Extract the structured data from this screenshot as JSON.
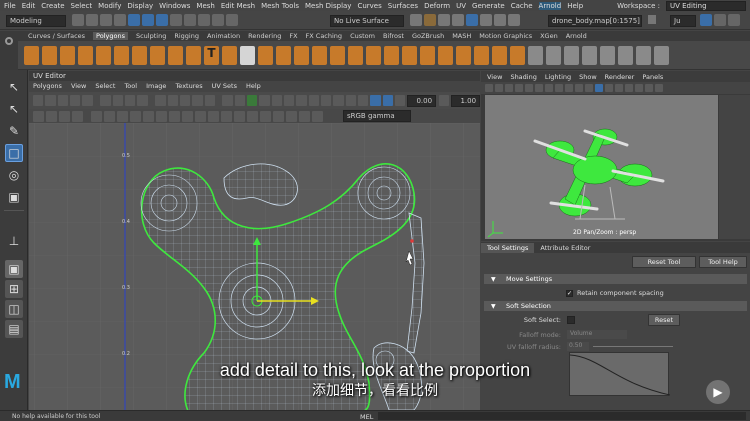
{
  "menubar": {
    "items": [
      "File",
      "Edit",
      "Create",
      "Select",
      "Modify",
      "Display",
      "Windows",
      "Mesh",
      "Edit Mesh",
      "Mesh Tools",
      "Mesh Display",
      "Curves",
      "Surfaces",
      "Deform",
      "UV",
      "Generate",
      "Cache",
      "Arnold",
      "Help"
    ],
    "workspace_label": "Workspace :",
    "workspace_value": "UV Editing"
  },
  "statusline": {
    "mode": "Modeling",
    "live_surface": "No Live Surface",
    "file_field": "drone_body.map[0:1575]",
    "user": "Ju"
  },
  "shelf_tabs": [
    "Curves / Surfaces",
    "Polygons",
    "Sculpting",
    "Rigging",
    "Animation",
    "Rendering",
    "FX",
    "FX Caching",
    "Custom",
    "Bifrost",
    "GoZBrush",
    "MASH",
    "Motion Graphics",
    "XGen",
    "Arnold"
  ],
  "shelf_active": "Polygons",
  "uv_editor": {
    "title": "UV Editor",
    "menu": [
      "Polygons",
      "View",
      "Select",
      "Tool",
      "Image",
      "Textures",
      "UV Sets",
      "Help"
    ],
    "field_a": "0.00",
    "field_b": "1.00",
    "color_space": "sRGB gamma",
    "ruler_ticks": [
      "0.5",
      "0.4",
      "0.3",
      "0.2"
    ]
  },
  "viewport": {
    "menu": [
      "View",
      "Shading",
      "Lighting",
      "Show",
      "Renderer",
      "Panels"
    ],
    "hud": "2D Pan/Zoom : persp"
  },
  "attr": {
    "tabs": [
      "Tool Settings",
      "Attribute Editor"
    ],
    "reset_tool": "Reset Tool",
    "tool_help": "Tool Help",
    "move_settings": "Move Settings",
    "retain_spacing": "Retain component spacing",
    "soft_selection": "Soft Selection",
    "soft_select": "Soft Select:",
    "reset": "Reset",
    "falloff_mode": "Falloff mode:",
    "falloff_mode_value": "Volume",
    "falloff_radius": "UV falloff radius:",
    "falloff_radius_value": "0.50"
  },
  "helpline": {
    "text": "No help available for this tool",
    "mel": "MEL"
  },
  "subtitle": {
    "en": "add detail to this, look at the proportion",
    "cn": "添加细节，看看比例"
  },
  "colors": {
    "accent": "#2d8fd6",
    "uv_green": "#3ee83e",
    "arnold": "#f0a030"
  }
}
